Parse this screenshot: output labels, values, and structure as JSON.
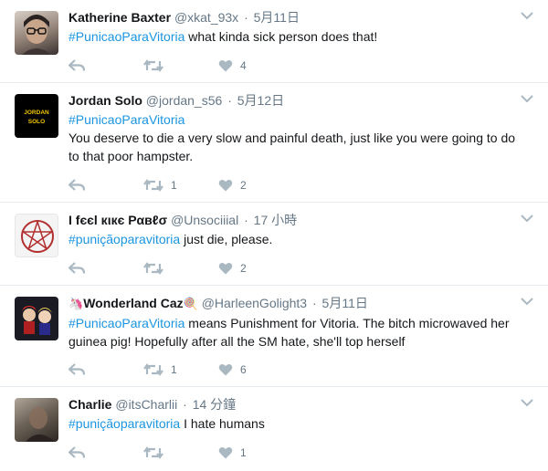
{
  "tweets": [
    {
      "name": "Katherine Baxter",
      "handle": "@xkat_93x",
      "time": "5月11日",
      "hashtag": "#PunicaoParaVitoria",
      "text": "what kinda sick person does that!",
      "retweets": "",
      "likes": "4",
      "avatar": "woman-with-glasses-avatar"
    },
    {
      "name": "Jordan Solo",
      "handle": "@jordan_s56",
      "time": "5月12日",
      "hashtag": "#PunicaoParaVitoria",
      "text": "You deserve to die a very slow and painful death, just like you were going to do to that poor hampster.",
      "retweets": "1",
      "likes": "2",
      "avatar": "jordan-solo-logo-avatar",
      "avatar_text": "JORDAN SOLO"
    },
    {
      "name": "I fєєl кιкє Pαвℓσ",
      "handle": "@Unsociiial",
      "time": "17 小時",
      "hashtag": "#puniçãoparavitoria",
      "text": "just die, please.",
      "retweets": "",
      "likes": "2",
      "avatar": "pentagram-avatar"
    },
    {
      "name": "Wonderland Caz",
      "name_emoji_before": "🦄",
      "name_emoji_after": "🍭",
      "handle": "@HarleenGolight3",
      "time": "5月11日",
      "hashtag": "#PunicaoParaVitoria",
      "text": "means Punishment for Vitoria. The bitch microwaved her guinea pig! Hopefully after all the SM hate, she'll top herself",
      "retweets": "1",
      "likes": "6",
      "avatar": "cartoon-characters-avatar"
    },
    {
      "name": "Charlie",
      "handle": "@itsCharlii",
      "time": "14 分鐘",
      "hashtag": "#puniçãoparavitoria",
      "text": "I hate humans",
      "retweets": "",
      "likes": "1",
      "avatar": "blurry-photo-avatar"
    }
  ],
  "icons": {
    "reply": "reply-icon",
    "retweet": "retweet-icon",
    "like": "heart-icon",
    "more": "chevron-down-icon"
  },
  "colors": {
    "hashtag": "#1b95e0",
    "secondary_text": "#657786",
    "icon": "#aab8c2",
    "divider": "#e6ecf0"
  }
}
